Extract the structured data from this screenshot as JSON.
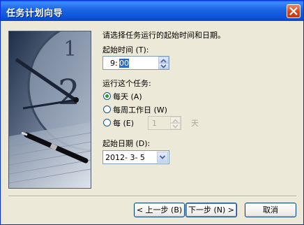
{
  "window": {
    "title": "任务计划向导"
  },
  "intro": "请选择任务运行的起始时间和日期。",
  "start_time": {
    "label": "起始时间 (T):",
    "hour": "9:",
    "minute": "00"
  },
  "run_task": {
    "label": "运行这个任务:",
    "options": [
      {
        "label": "每天 (A)",
        "selected": true
      },
      {
        "label": "每周工作日 (W)",
        "selected": false
      },
      {
        "label": "每 (E)",
        "selected": false
      }
    ],
    "every_value": "1",
    "every_unit": "天"
  },
  "start_date": {
    "label": "起始日期 (D):",
    "value": "2012- 3- 5"
  },
  "buttons": {
    "back": "< 上一步 (B)",
    "next": "下一步 (N) >",
    "cancel": "取消"
  }
}
